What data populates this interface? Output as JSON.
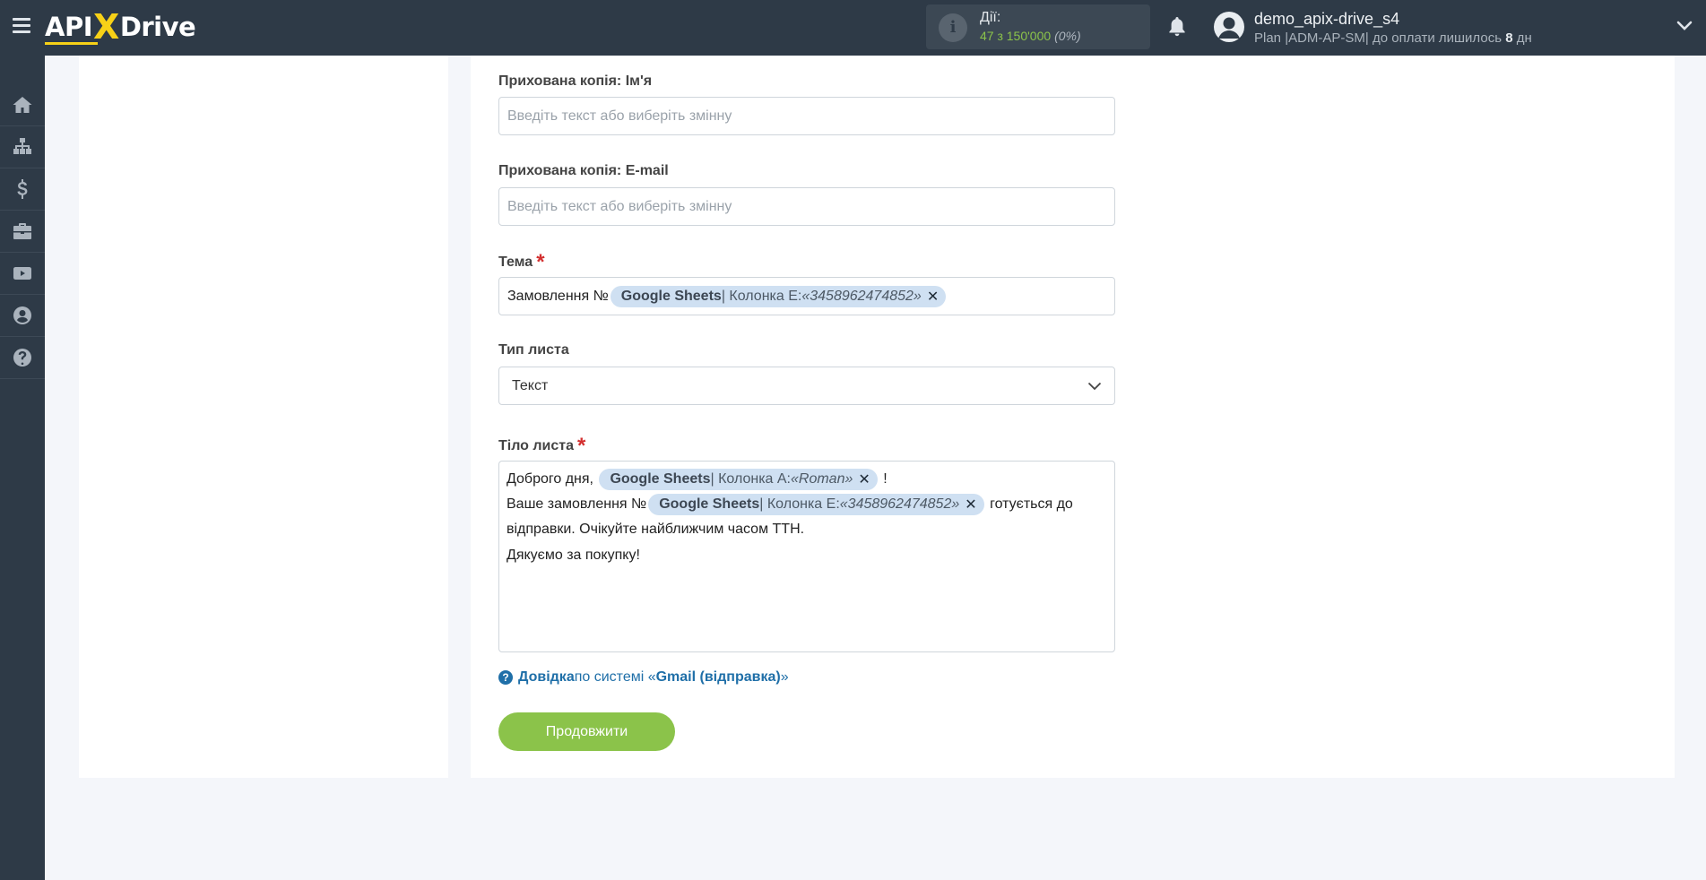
{
  "topbar": {
    "logo_api": "API",
    "logo_x": "X",
    "logo_drive": "Drive",
    "actions_label": "Дії:",
    "actions_count": "47 з 150'000",
    "actions_percent": "(0%)",
    "username": "demo_apix-drive_s4",
    "plan_prefix": "Plan |ADM-AP-SM| до оплати лишилось ",
    "plan_days": "8",
    "plan_suffix": " дн",
    "info_glyph": "i"
  },
  "sidebar": {
    "items": [
      {
        "name": "home-icon"
      },
      {
        "name": "sitemap-icon"
      },
      {
        "name": "dollar-icon"
      },
      {
        "name": "briefcase-icon"
      },
      {
        "name": "youtube-icon"
      },
      {
        "name": "user-circle-icon"
      },
      {
        "name": "question-circle-icon"
      }
    ]
  },
  "form": {
    "bcc_name_label": "Прихована копія: Ім'я",
    "bcc_name_placeholder": "Введіть текст або виберіть змінну",
    "bcc_email_label": "Прихована копія: E-mail",
    "bcc_email_placeholder": "Введіть текст або виберіть змінну",
    "subject_label": "Тема",
    "required_mark": "*",
    "subject_prefix": "Замовлення №",
    "subject_tag": {
      "source": "Google Sheets",
      "column": " | Колонка E: ",
      "value": "«3458962474852»",
      "remove": "✕"
    },
    "mail_type_label": "Тип листа",
    "mail_type_value": "Текст",
    "body_label": "Тіло листа",
    "body": {
      "line1_prefix": "Доброго дня,",
      "line1_tag": {
        "source": "Google Sheets",
        "column": " | Колонка A: ",
        "value": "«Roman»",
        "remove": "✕"
      },
      "line1_suffix": "!",
      "line2_prefix": "Ваше замовлення №",
      "line2_tag": {
        "source": "Google Sheets",
        "column": " | Колонка E: ",
        "value": "«3458962474852»",
        "remove": "✕"
      },
      "line2_suffix": "готується до",
      "line3": "відправки. Очікуйте найближчим часом ТТН.",
      "line4": "Дякуємо за покупку!"
    },
    "help_glyph": "?",
    "help_link": "Довідка",
    "help_mid": " по системі «",
    "help_system": "Gmail (відправка)",
    "help_end": "»",
    "continue_button": "Продовжити"
  },
  "colors": {
    "topbar_bg": "#2e3a47",
    "accent_green": "#8bc34a",
    "logo_yellow": "#f7d117",
    "tag_bg": "#cfe0f2",
    "link_blue": "#1f6fa8",
    "required_red": "#d32f2f"
  }
}
